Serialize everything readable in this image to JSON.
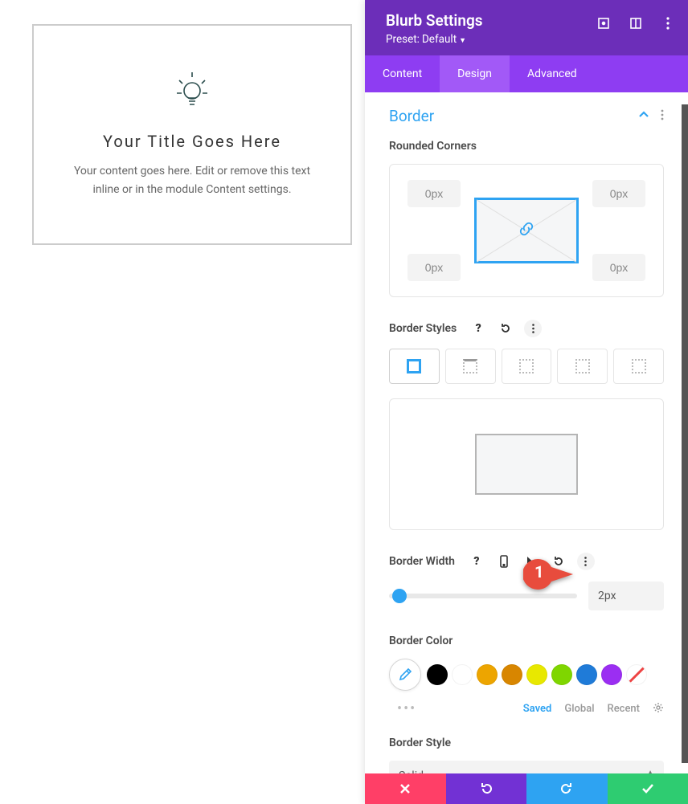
{
  "module": {
    "title": "Your Title Goes Here",
    "content": "Your content goes here. Edit or remove this text inline or in the module Content settings."
  },
  "panel": {
    "title": "Blurb Settings",
    "preset_label": "Preset:",
    "preset_value": "Default",
    "tabs": {
      "content": "Content",
      "design": "Design",
      "advanced": "Advanced"
    },
    "section": "Border"
  },
  "rounded": {
    "label": "Rounded Corners",
    "tl": "0px",
    "tr": "0px",
    "bl": "0px",
    "br": "0px"
  },
  "bstyles": {
    "label": "Border Styles"
  },
  "bwidth": {
    "label": "Border Width",
    "value": "2px"
  },
  "bcolor": {
    "label": "Border Color",
    "swatches": [
      "#000000",
      "#ffffff",
      "#eda500",
      "#d88600",
      "#e8e800",
      "#7fd600",
      "#1f7bd8",
      "#9b2ef2"
    ],
    "tabs": {
      "saved": "Saved",
      "global": "Global",
      "recent": "Recent"
    }
  },
  "bstyle": {
    "label": "Border Style",
    "value": "Solid"
  },
  "callout_num": "1"
}
